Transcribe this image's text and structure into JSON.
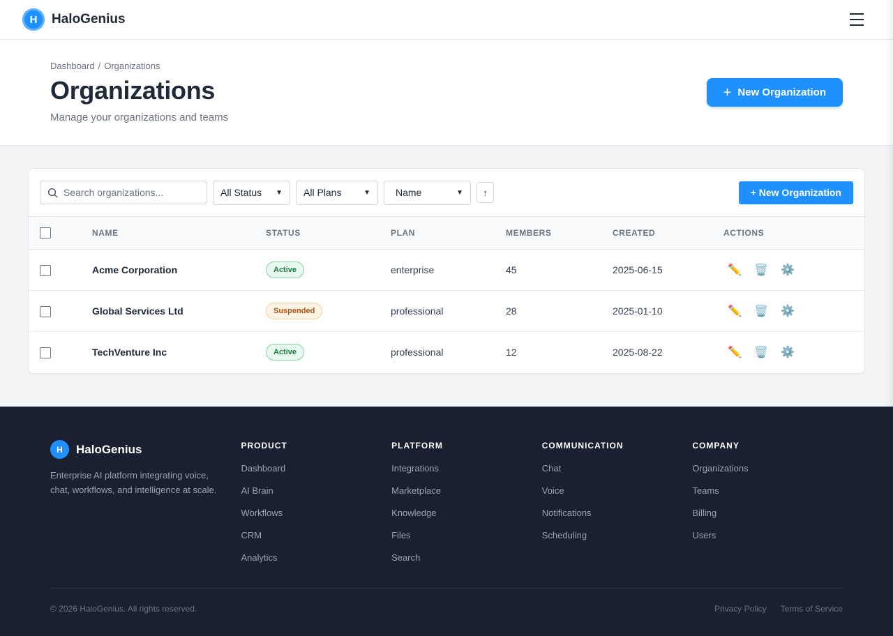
{
  "nav": {
    "brand": "HaloGenius",
    "logo_letter": "H",
    "menu_icon": "hamburger-menu-icon"
  },
  "header": {
    "breadcrumb": [
      "Dashboard",
      "/",
      "Organizations"
    ],
    "title": "Organizations",
    "subtitle": "Manage your organizations and teams",
    "new_button": "New Organization"
  },
  "toolbar": {
    "search_placeholder": "Search organizations...",
    "status_filter": "All Status",
    "plan_filter": "All Plans",
    "sort_by": "Name",
    "sort_direction": "↑",
    "new_button": "+ New Organization"
  },
  "table": {
    "columns": [
      "Name",
      "Status",
      "Plan",
      "Members",
      "Created",
      "Actions"
    ],
    "rows": [
      {
        "name": "Acme Corporation",
        "status": "Active",
        "plan": "enterprise",
        "members": "45",
        "created": "2025-06-15"
      },
      {
        "name": "Global Services Ltd",
        "status": "Suspended",
        "plan": "professional",
        "members": "28",
        "created": "2025-01-10"
      },
      {
        "name": "TechVenture Inc",
        "status": "Active",
        "plan": "professional",
        "members": "12",
        "created": "2025-08-22"
      }
    ],
    "action_icons": [
      "✏️",
      "🗑️",
      "⚙️"
    ]
  },
  "footer": {
    "brand": "HaloGenius",
    "logo_letter": "H",
    "description": "Enterprise AI platform integrating voice, chat, workflows, and intelligence at scale.",
    "columns": [
      {
        "title": "PRODUCT",
        "links": [
          "Dashboard",
          "AI Brain",
          "Workflows",
          "CRM",
          "Analytics"
        ]
      },
      {
        "title": "PLATFORM",
        "links": [
          "Integrations",
          "Marketplace",
          "Knowledge",
          "Files",
          "Search"
        ]
      },
      {
        "title": "COMMUNICATION",
        "links": [
          "Chat",
          "Voice",
          "Notifications",
          "Scheduling"
        ]
      },
      {
        "title": "COMPANY",
        "links": [
          "Organizations",
          "Teams",
          "Billing",
          "Users"
        ]
      }
    ],
    "copyright": "© 2026 HaloGenius. All rights reserved.",
    "legal": [
      "Privacy Policy",
      "Terms of Service"
    ]
  },
  "colors": {
    "accent": "#1e90ff",
    "footer_bg": "#1b2030",
    "active": "#15803d",
    "suspended": "#b45309"
  }
}
